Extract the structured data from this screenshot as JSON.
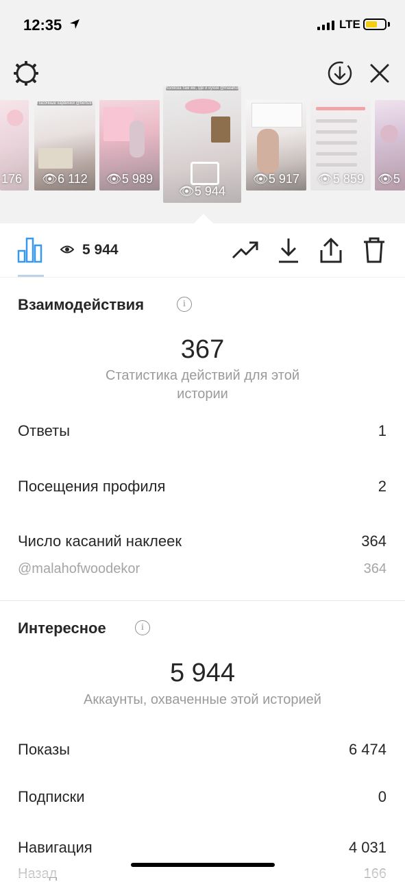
{
  "status": {
    "time": "12:35",
    "network": "LTE",
    "battery_color": "#f5cc14"
  },
  "thumbnails": [
    {
      "count": "176"
    },
    {
      "count": "6 112",
      "caption": "Пасочные карвинки @bertutix"
    },
    {
      "count": "5 989"
    },
    {
      "count": "5 944",
      "caption": "Коляска там же, где и кухня @malahofwoodekor",
      "active": true
    },
    {
      "count": "5 917"
    },
    {
      "count": "5 859"
    },
    {
      "count": "5"
    }
  ],
  "toolbar": {
    "views": "5 944"
  },
  "interactions": {
    "title": "Взаимодействия",
    "total": "367",
    "caption": "Статистика действий для этой истории",
    "rows": [
      {
        "label": "Ответы",
        "value": "1"
      },
      {
        "label": "Посещения профиля",
        "value": "2"
      },
      {
        "label": "Число касаний наклеек",
        "value": "364"
      }
    ],
    "sticker": {
      "label": "@malahofwoodekor",
      "value": "364"
    }
  },
  "discovery": {
    "title": "Интересное",
    "total": "5 944",
    "caption": "Аккаунты, охваченные этой историей",
    "rows": [
      {
        "label": "Показы",
        "value": "6 474"
      },
      {
        "label": "Подписки",
        "value": "0"
      },
      {
        "label": "Навигация",
        "value": "4 031"
      },
      {
        "label": "Назад",
        "value": "166"
      }
    ]
  },
  "colors": {
    "accent": "#3897f0",
    "text": "#262626",
    "secondary": "#9a9a9a",
    "header_bg": "#f2f2f3"
  },
  "icons": [
    "location-arrow-icon",
    "signal-icon",
    "battery-icon",
    "gear-icon",
    "download-circle-icon",
    "close-icon",
    "eye-icon",
    "bar-chart-icon",
    "trending-icon",
    "download-icon",
    "share-icon",
    "trash-icon",
    "info-icon"
  ]
}
